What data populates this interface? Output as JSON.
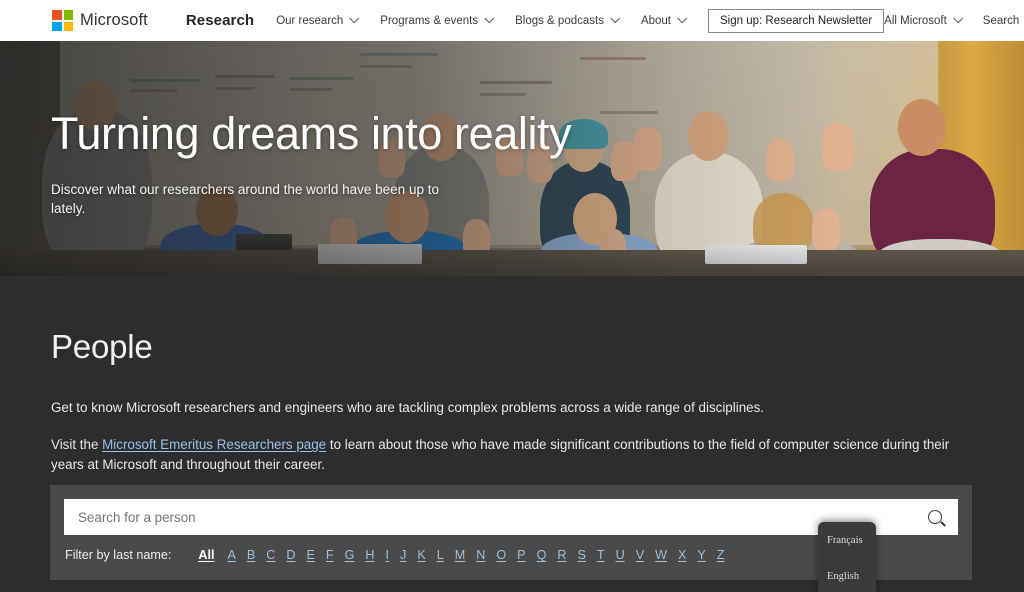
{
  "topnav": {
    "logo_alt": "Microsoft",
    "brand": "Research",
    "links": [
      {
        "label": "Our research"
      },
      {
        "label": "Programs & events"
      },
      {
        "label": "Blogs & podcasts"
      },
      {
        "label": "About"
      }
    ],
    "newsletter_button": "Sign up: Research Newsletter",
    "all_microsoft": "All Microsoft",
    "search_label": "Search"
  },
  "hero": {
    "title": "Turning dreams into reality",
    "subtitle": "Discover what our researchers around the world have been up to lately."
  },
  "main": {
    "page_title": "People",
    "paragraph_1": "Get to know Microsoft researchers and engineers who are tackling complex problems across a wide range of disciplines.",
    "paragraph_2_before": "Visit the ",
    "paragraph_2_link": "Microsoft Emeritus Researchers page",
    "paragraph_2_after": " to learn about those who have made significant contributions to the field of computer science during their years at Microsoft and throughout their career."
  },
  "search": {
    "placeholder": "Search for a person",
    "value": "",
    "submit_label": "Search"
  },
  "filter": {
    "label": "Filter by last name:",
    "all_label": "All",
    "letters": [
      "A",
      "B",
      "C",
      "D",
      "E",
      "F",
      "G",
      "H",
      "I",
      "J",
      "K",
      "L",
      "M",
      "N",
      "O",
      "P",
      "Q",
      "R",
      "S",
      "T",
      "U",
      "V",
      "W",
      "X",
      "Y",
      "Z"
    ]
  },
  "language_popup": {
    "items": [
      {
        "label": "Français"
      },
      {
        "label": "English"
      }
    ]
  },
  "colors": {
    "page_background": "#2d2d2d",
    "panel_background": "#4a4a4a",
    "link_blue": "#99c0ea",
    "nav_background": "#ffffff",
    "logo_red": "#f25022",
    "logo_green": "#7fba00",
    "logo_blue": "#00a4ef",
    "logo_yellow": "#ffb900"
  }
}
